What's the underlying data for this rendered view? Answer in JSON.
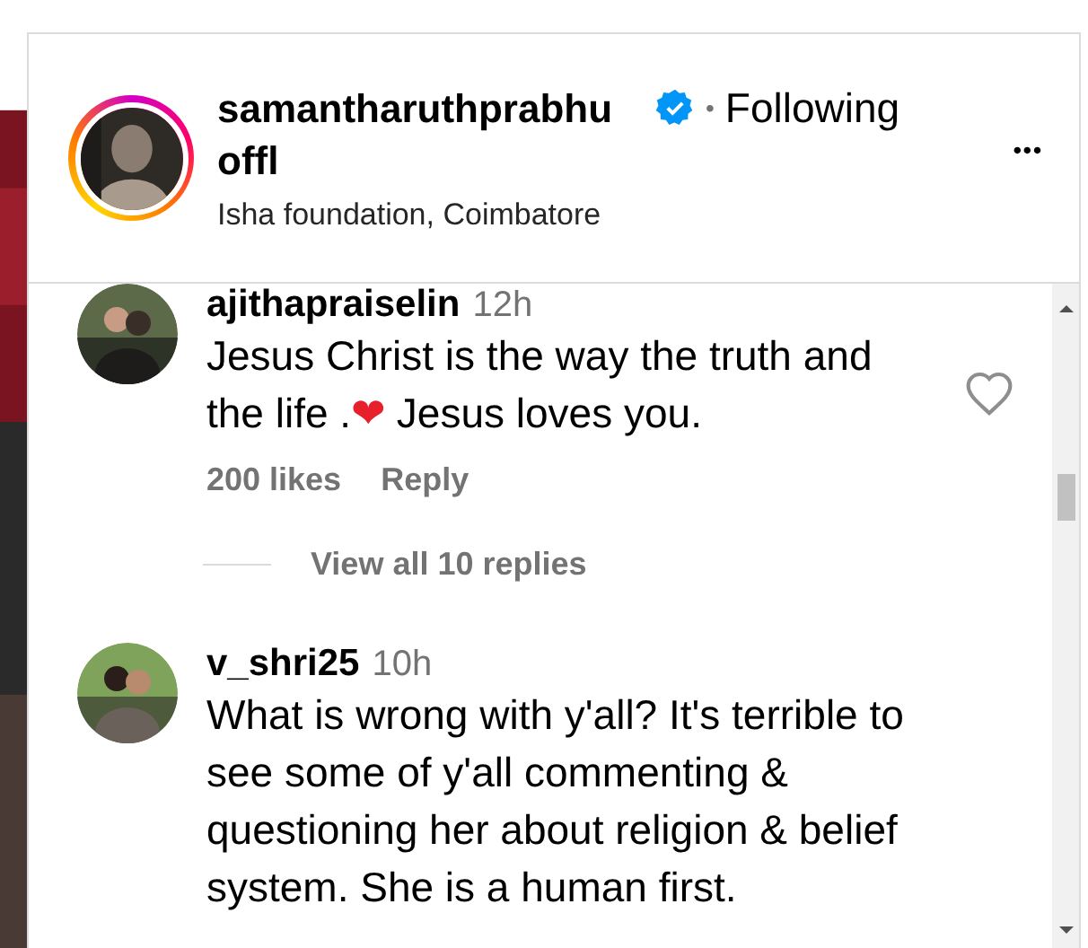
{
  "header": {
    "username": "samantharuthprabhu offl",
    "verified": true,
    "separator": "•",
    "follow_label": "Following",
    "location": "Isha foundation, Coimbatore",
    "more": "•••"
  },
  "comments": [
    {
      "username": "ajithapraiselin",
      "time": "12h",
      "body": [
        {
          "kind": "text",
          "text": "Jesus Christ is the way the truth and the life ."
        },
        {
          "kind": "emoji",
          "text": "❤"
        },
        {
          "kind": "text",
          "text": " Jesus loves you."
        }
      ],
      "likes": "200 likes",
      "reply": "Reply",
      "liked": false,
      "replies": "View all 10 replies"
    },
    {
      "username": "v_shri25",
      "time": "10h",
      "body": [
        {
          "kind": "text",
          "text": "What is wrong with y'all? It's terrible to see some of y'all commenting & questioning her about religion & belief system. She is a human first."
        }
      ]
    }
  ]
}
